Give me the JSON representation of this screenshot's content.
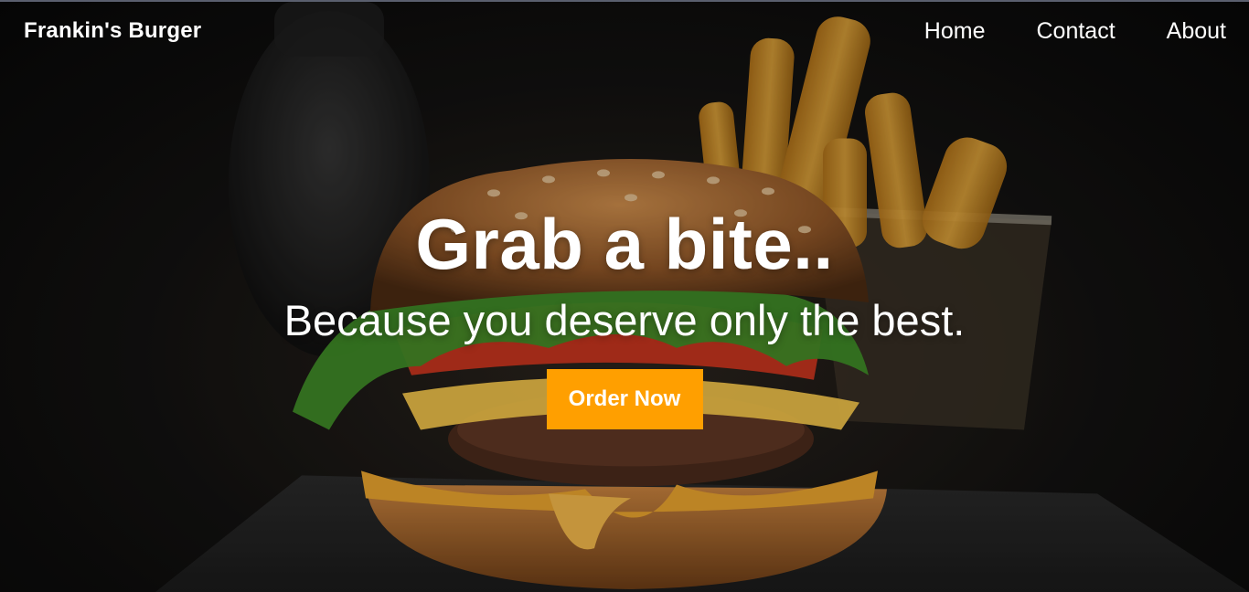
{
  "nav": {
    "brand": "Frankin's Burger",
    "links": [
      {
        "label": "Home"
      },
      {
        "label": "Contact"
      },
      {
        "label": "About"
      }
    ]
  },
  "hero": {
    "title": "Grab a bite..",
    "subtitle": "Because you deserve only the best.",
    "cta_label": "Order Now",
    "background_image": "burger-and-fries-photo"
  },
  "colors": {
    "accent": "#ff9f00",
    "text": "#ffffff",
    "background": "#0a0a0a"
  }
}
